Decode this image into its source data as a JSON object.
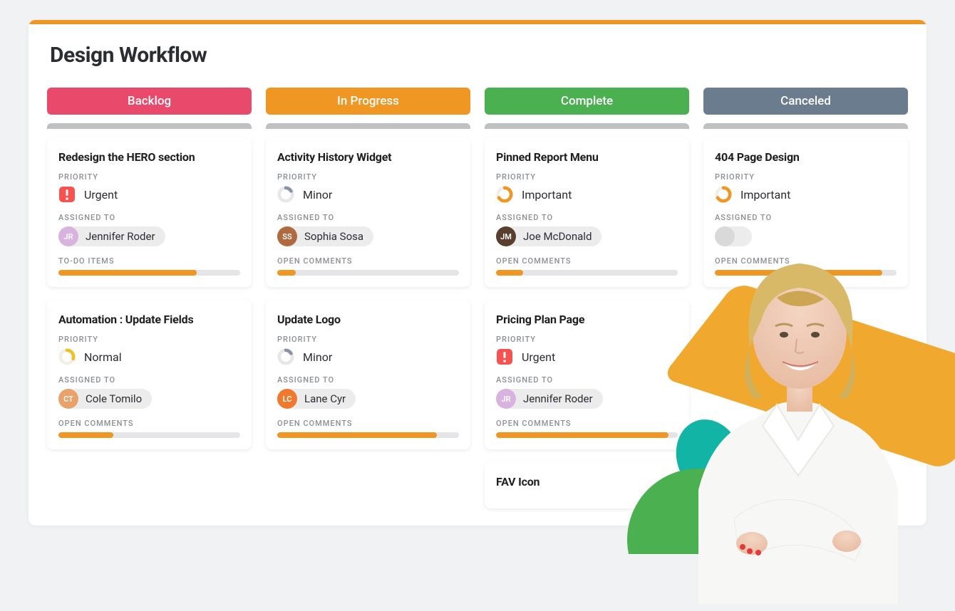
{
  "board": {
    "title": "Design Workflow",
    "accent_color": "#ef9623",
    "labels": {
      "priority": "PRIORITY",
      "assigned_to": "ASSIGNED TO",
      "todo_items": "TO-DO ITEMS",
      "open_comments": "OPEN COMMENTS"
    },
    "columns": [
      {
        "name": "Backlog",
        "color": "#e94a6b",
        "cards": [
          {
            "title": "Redesign the HERO section",
            "priority": {
              "level": "Urgent",
              "icon": "urgent"
            },
            "assignee": {
              "name": "Jennifer Roder",
              "avatar_bg": "#d9b3e0"
            },
            "progress_label": "TO-DO ITEMS",
            "progress_pct": 76
          },
          {
            "title": "Automation : Update Fields",
            "priority": {
              "level": "Normal",
              "icon": "normal"
            },
            "assignee": {
              "name": "Cole Tomilo",
              "avatar_bg": "#e8a26a"
            },
            "progress_label": "OPEN COMMENTS",
            "progress_pct": 30
          }
        ]
      },
      {
        "name": "In Progress",
        "color": "#ef9623",
        "cards": [
          {
            "title": "Activity History Widget",
            "priority": {
              "level": "Minor",
              "icon": "minor"
            },
            "assignee": {
              "name": "Sophia Sosa",
              "avatar_bg": "#b06a3f"
            },
            "progress_label": "OPEN COMMENTS",
            "progress_pct": 10
          },
          {
            "title": "Update Logo",
            "priority": {
              "level": "Minor",
              "icon": "minor"
            },
            "assignee": {
              "name": "Lane Cyr",
              "avatar_bg": "#ef7a2e"
            },
            "progress_label": "OPEN COMMENTS",
            "progress_pct": 88
          }
        ]
      },
      {
        "name": "Complete",
        "color": "#4bb04f",
        "cards": [
          {
            "title": "Pinned Report Menu",
            "priority": {
              "level": "Important",
              "icon": "important"
            },
            "assignee": {
              "name": "Joe McDonald",
              "avatar_bg": "#5a3f2e"
            },
            "progress_label": "OPEN COMMENTS",
            "progress_pct": 15
          },
          {
            "title": "Pricing Plan Page",
            "priority": {
              "level": "Urgent",
              "icon": "urgent"
            },
            "assignee": {
              "name": "Jennifer Roder",
              "avatar_bg": "#d9b3e0"
            },
            "progress_label": "OPEN COMMENTS",
            "progress_pct": 95
          },
          {
            "title": "FAV Icon",
            "priority": {
              "level": "",
              "icon": ""
            },
            "assignee": {
              "name": "",
              "avatar_bg": ""
            },
            "progress_label": "",
            "progress_pct": 0
          }
        ]
      },
      {
        "name": "Canceled",
        "color": "#6b7c8e",
        "cards": [
          {
            "title": "404 Page Design",
            "priority": {
              "level": "Important",
              "icon": "important"
            },
            "assignee": {
              "name": "",
              "avatar_bg": "#d9d9d9"
            },
            "progress_label": "OPEN COMMENTS",
            "progress_pct": 92
          }
        ]
      }
    ]
  }
}
